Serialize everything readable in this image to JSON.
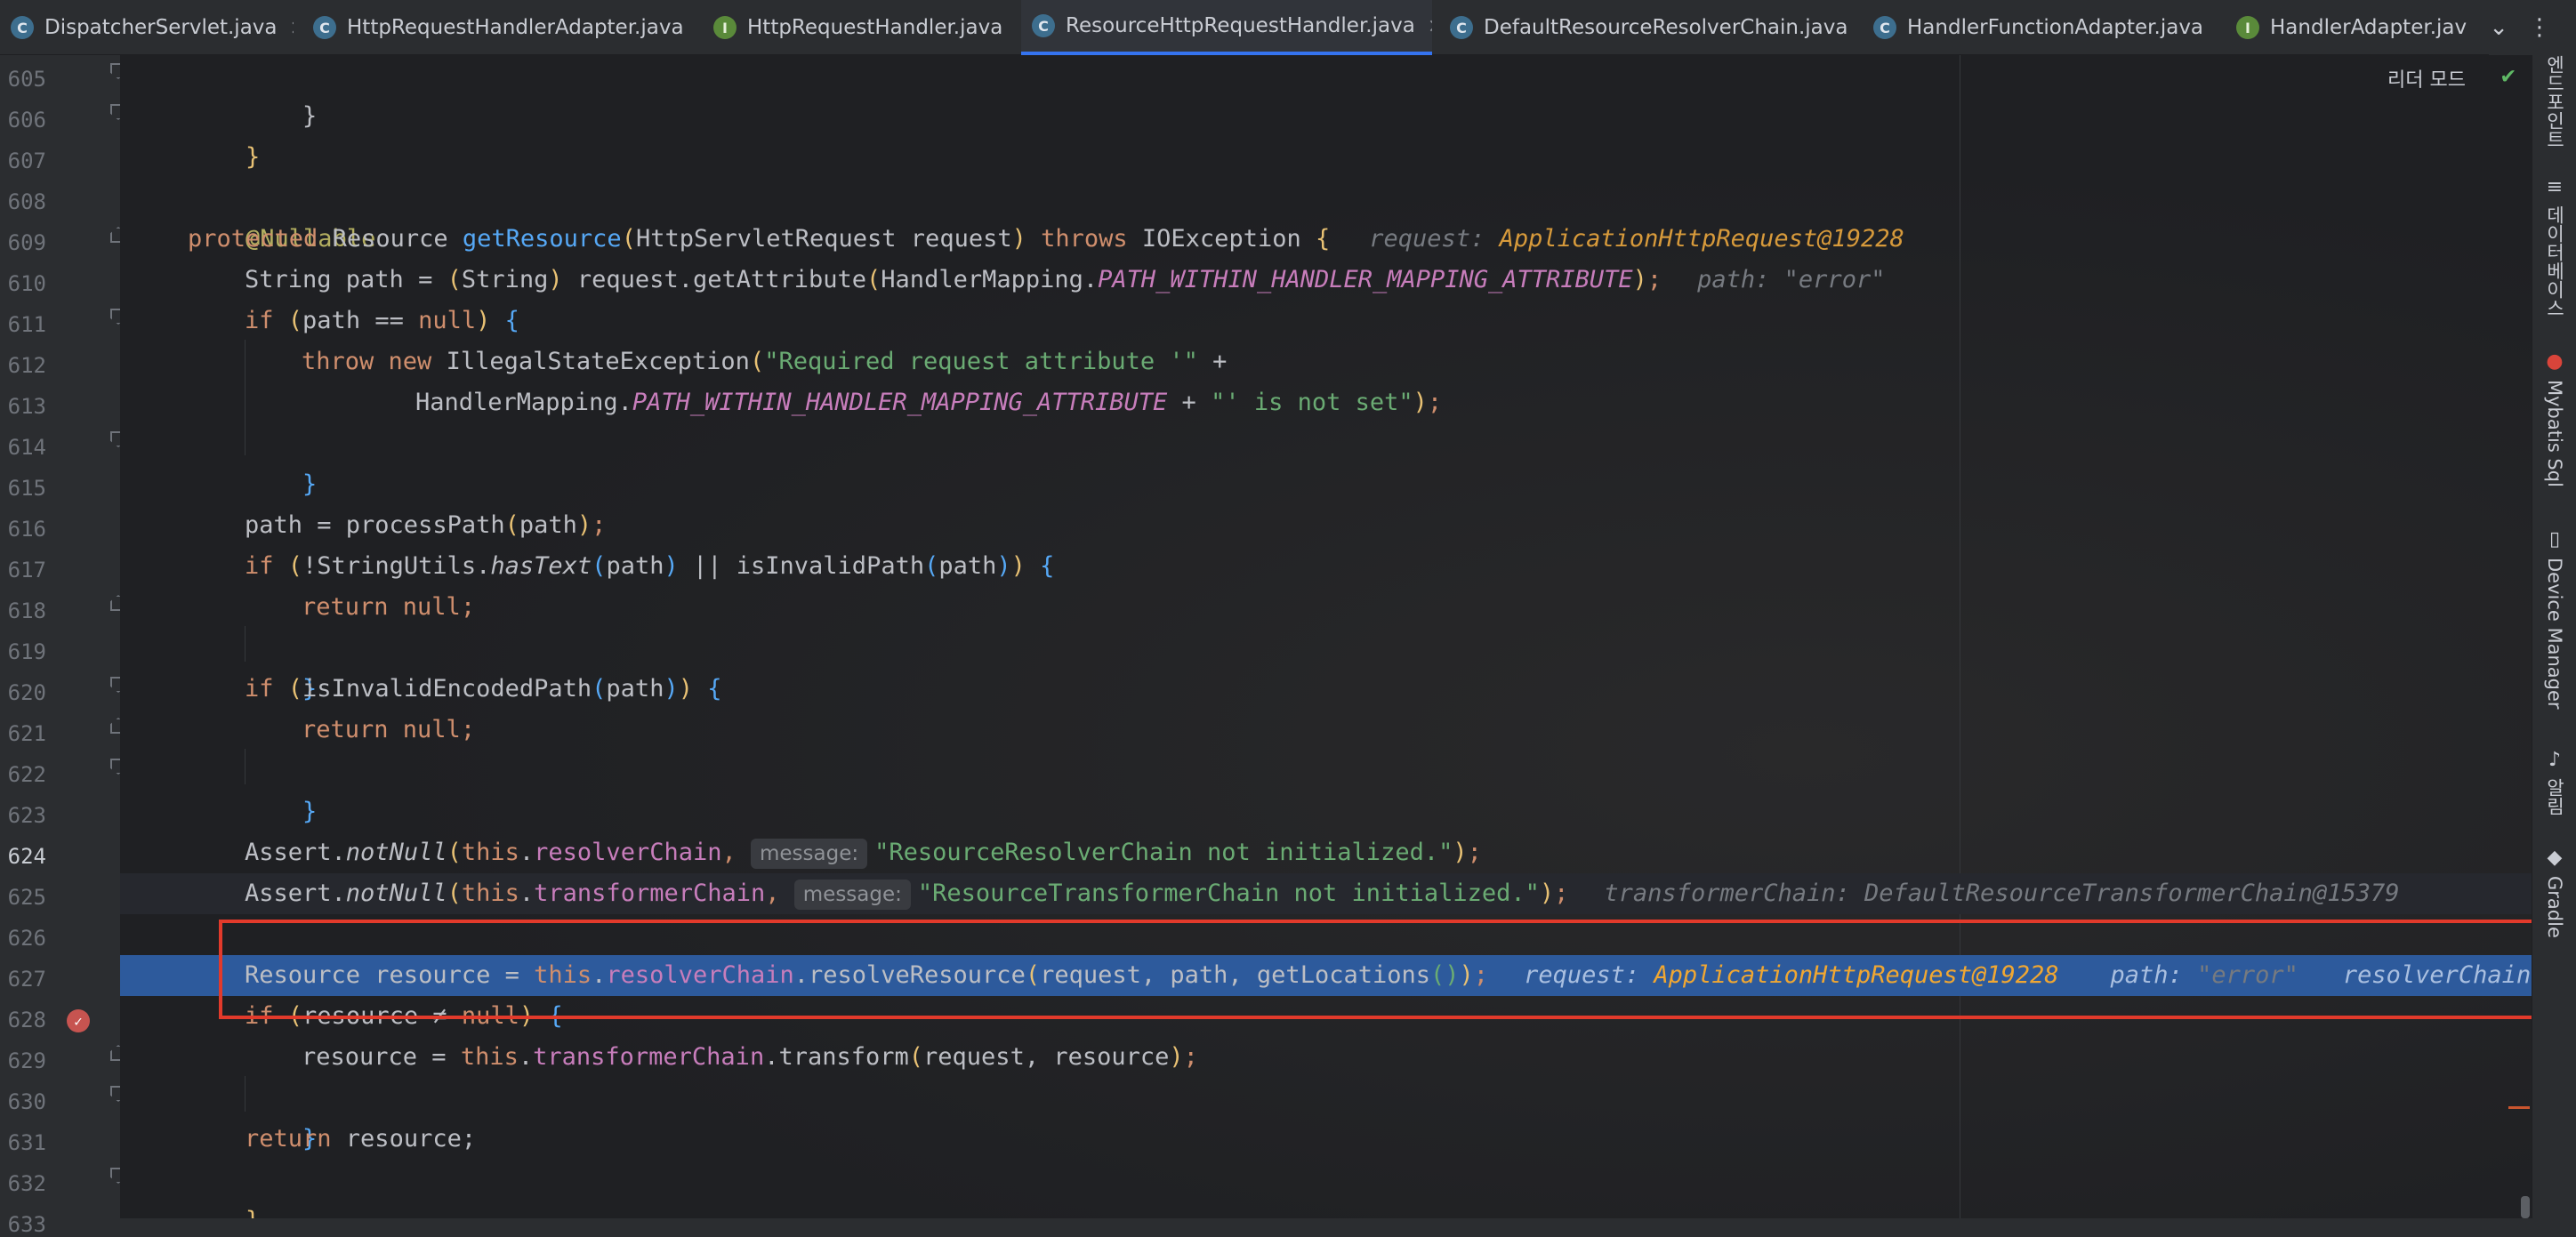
{
  "tabs": [
    {
      "icon": "C",
      "kind": "class",
      "label": "DispatcherServlet.java",
      "active": false
    },
    {
      "icon": "C",
      "kind": "class",
      "label": "HttpRequestHandlerAdapter.java",
      "active": false
    },
    {
      "icon": "I",
      "kind": "interface",
      "label": "HttpRequestHandler.java",
      "active": false
    },
    {
      "icon": "C",
      "kind": "class",
      "label": "ResourceHttpRequestHandler.java",
      "active": true
    },
    {
      "icon": "C",
      "kind": "class",
      "label": "DefaultResourceResolverChain.java",
      "active": false
    },
    {
      "icon": "C",
      "kind": "class",
      "label": "HandlerFunctionAdapter.java",
      "active": false
    },
    {
      "icon": "I",
      "kind": "interface",
      "label": "HandlerAdapter.jav",
      "active": false
    }
  ],
  "tab_close_glyph": "×",
  "tab_overflow_glyph": "⌄",
  "tab_menu_glyph": "⋮",
  "reader_mode_label": "리더 모드",
  "check_glyph": "✔",
  "breakpoint_glyph": "✓",
  "line_numbers": [
    "605",
    "606",
    "607",
    "608",
    "609",
    "610",
    "611",
    "612",
    "613",
    "614",
    "615",
    "616",
    "617",
    "618",
    "619",
    "620",
    "621",
    "622",
    "623",
    "624",
    "625",
    "626",
    "627",
    "628",
    "629",
    "630",
    "631",
    "632",
    "633"
  ],
  "current_line": "625",
  "execution_line": "627",
  "code": {
    "l605": "}",
    "l606": "}",
    "l608": "@Nullable",
    "l609": {
      "kw1": "protected ",
      "type": "Resource ",
      "name": "getResource",
      "p1": "(",
      "params": "HttpServletRequest request",
      "p2": ")",
      "kw2": " throws ",
      "exc": "IOException ",
      "brace": "{",
      "dbg_key": "request: ",
      "dbg_val": "ApplicationHttpRequest@19228"
    },
    "l610": {
      "a": "String path = ",
      "p1": "(",
      "cast": "String",
      "p2": ")",
      "b": " request.getAttribute",
      "p3": "(",
      "c": "HandlerMapping.",
      "cst": "PATH_WITHIN_HANDLER_MAPPING_ATTRIBUTE",
      "p4": ")",
      "d": ";",
      "dbg_key": "path: ",
      "dbg_val": "\"error\""
    },
    "l611": {
      "kw": "if ",
      "p1": "(",
      "a": "path ",
      "op": "== ",
      "kw2": "null",
      "p2": ")",
      "brace": " {"
    },
    "l612": {
      "kw": "throw new ",
      "a": "IllegalStateException",
      "p1": "(",
      "str": "\"Required request attribute '\"",
      "b": " +"
    },
    "l613": {
      "a": "HandlerMapping.",
      "cst": "PATH_WITHIN_HANDLER_MAPPING_ATTRIBUTE",
      "b": " + ",
      "str": "\"' is not set\"",
      "p1": ")",
      "c": ";"
    },
    "l614": "}",
    "l616": {
      "a": "path = processPath",
      "p1": "(",
      "b": "path",
      "p2": ")",
      "c": ";"
    },
    "l617": {
      "kw": "if ",
      "p1": "(",
      "a": "!StringUtils.",
      "m": "hasText",
      "p2": "(",
      "b": "path",
      "p3": ")",
      "op": " || ",
      "c": "isInvalidPath",
      "p4": "(",
      "d": "path",
      "p5": ")",
      "p6": ")",
      "brace": " {"
    },
    "l618": {
      "kw": "return null",
      "a": ";"
    },
    "l619": "}",
    "l620": {
      "kw": "if ",
      "p1": "(",
      "a": "isInvalidEncodedPath",
      "p2": "(",
      "b": "path",
      "p3": ")",
      "p4": ")",
      "brace": " {"
    },
    "l621": {
      "kw": "return null",
      "a": ";"
    },
    "l622": "}",
    "l624": {
      "a": "Assert.",
      "m": "notNull",
      "p1": "(",
      "kw": "this",
      "b": ".",
      "f": "resolverChain",
      "c": ", ",
      "hint": "message:",
      "str": "\"ResourceResolverChain not initialized.\"",
      "p2": ")",
      "d": ";"
    },
    "l625": {
      "a": "Assert.",
      "m": "notNull",
      "p1": "(",
      "kw": "this",
      "b": ".",
      "f": "transformerChain",
      "c": ", ",
      "hint": "message:",
      "str": "\"ResourceTransformerChain not initialized.\"",
      "p2": ")",
      "d": ";",
      "dbg_key": "transformerChain: ",
      "dbg_val": "DefaultResourceTransformerChain@15379"
    },
    "l627": {
      "a": "Resource resource = ",
      "kw": "this",
      "b": ".",
      "f": "resolverChain",
      "c": ".resolveResource",
      "p1": "(",
      "d": "request, path, getLocations",
      "p2": "(",
      "p3": ")",
      "p4": ")",
      "e": ";",
      "dbg1_key": "request: ",
      "dbg1_val": "ApplicationHttpRequest@19228",
      "dbg2_key": "path: ",
      "dbg2_val": "\"error\"",
      "dbg3_key": "resolverChain:"
    },
    "l628": {
      "kw": "if ",
      "p1": "(",
      "a": "resource ",
      "op": "≠ ",
      "kw2": "null",
      "p2": ")",
      "brace": " {"
    },
    "l629": {
      "a": "resource = ",
      "kw": "this",
      "b": ".",
      "f": "transformerChain",
      "c": ".transform",
      "p1": "(",
      "d": "request, resource",
      "p2": ")",
      "e": ";"
    },
    "l630": "}",
    "l631": {
      "kw": "return ",
      "a": "resource;"
    },
    "l632": "}"
  },
  "tool_windows": [
    {
      "icon": "endpoint-icon",
      "label": "엔드포인트"
    },
    {
      "icon": "database-icon",
      "label": "데이터베이스"
    },
    {
      "icon": "mybatis-icon",
      "label": "Mybatis Sql"
    },
    {
      "icon": "device-manager-icon",
      "label": "Device Manager"
    },
    {
      "icon": "notifications-icon",
      "label": "알림"
    },
    {
      "icon": "gradle-icon",
      "label": "Gradle"
    }
  ]
}
